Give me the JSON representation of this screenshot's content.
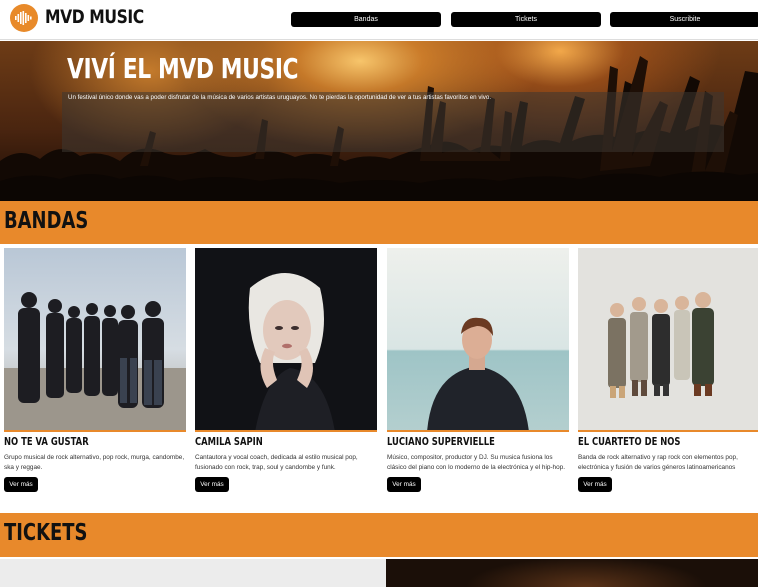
{
  "header": {
    "brand": "MVD MUSIC",
    "nav": [
      {
        "label": "Bandas"
      },
      {
        "label": "Tickets"
      },
      {
        "label": "Suscribite"
      }
    ]
  },
  "hero": {
    "title": "VIVÍ EL MVD MUSIC",
    "text": "Un festival único donde vas a poder disfrutar de la música de varios artistas uruguayos. No te pierdas la oportunidad de ver a tus artistas favoritos en vivo."
  },
  "bandas": {
    "title": "BANDAS",
    "cards": [
      {
        "name": "NO TE VA GUSTAR",
        "description": "Grupo musical de rock alternativo, pop rock, murga, candombe, ska y reggae.",
        "button": "Ver más"
      },
      {
        "name": "CAMILA SAPIN",
        "description": "Cantautora y vocal coach, dedicada al estilo musical pop, fusionado con rock, trap, soul y candombe y funk.",
        "button": "Ver más"
      },
      {
        "name": "LUCIANO SUPERVIELLE",
        "description": "Músico, compositor, productor y DJ. Su musica fusiona los clásico del piano con lo moderno de la electrónica y el hip-hop.",
        "button": "Ver más"
      },
      {
        "name": "EL CUARTETO DE NOS",
        "description": "Banda de rock alternativo y rap rock con elementos pop, electrónica y fusión de varios géneros latinoamericanos",
        "button": "Ver más"
      }
    ]
  },
  "tickets": {
    "title": "TICKETS"
  },
  "colors": {
    "accent": "#e8892b",
    "button": "#000000"
  }
}
